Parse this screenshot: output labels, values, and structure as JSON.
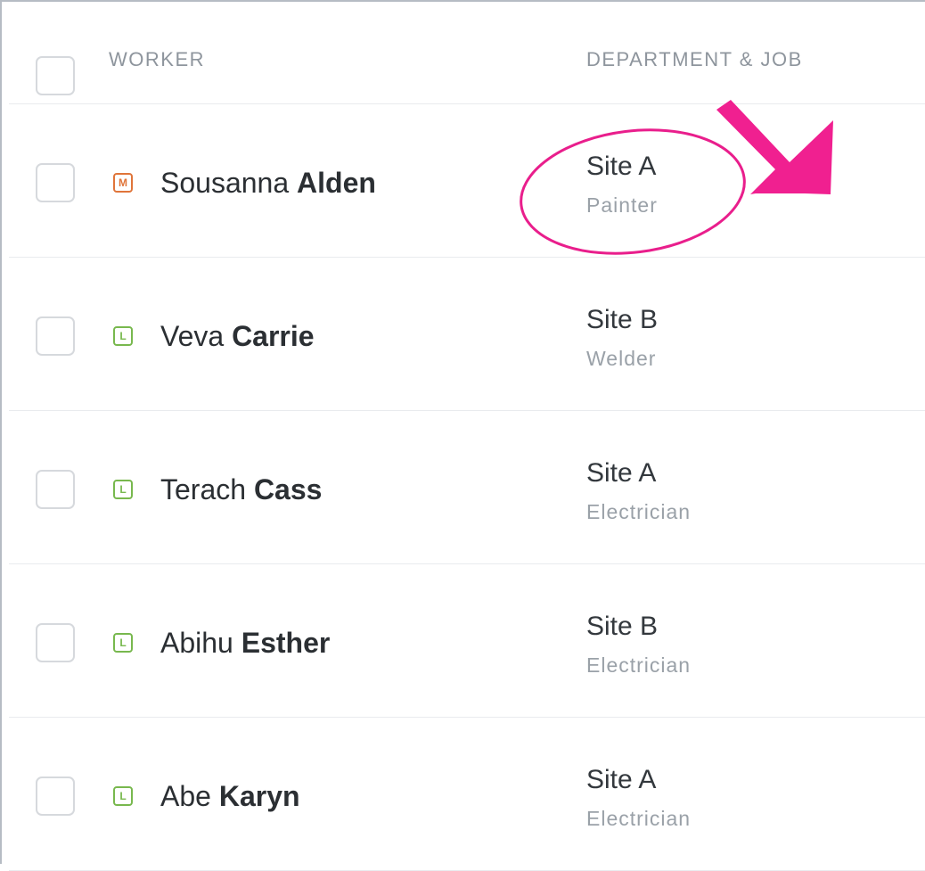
{
  "table": {
    "columns": {
      "worker": "WORKER",
      "department": "DEPARTMENT & JOB"
    },
    "rows": [
      {
        "badge": "M",
        "badge_color": "#e0753a",
        "first_name": "Sousanna",
        "last_name": "Alden",
        "site": "Site A",
        "job": "Painter"
      },
      {
        "badge": "L",
        "badge_color": "#78b84e",
        "first_name": "Veva",
        "last_name": "Carrie",
        "site": "Site B",
        "job": "Welder"
      },
      {
        "badge": "L",
        "badge_color": "#78b84e",
        "first_name": "Terach",
        "last_name": "Cass",
        "site": "Site A",
        "job": "Electrician"
      },
      {
        "badge": "L",
        "badge_color": "#78b84e",
        "first_name": "Abihu",
        "last_name": "Esther",
        "site": "Site B",
        "job": "Electrician"
      },
      {
        "badge": "L",
        "badge_color": "#78b84e",
        "first_name": "Abe",
        "last_name": "Karyn",
        "site": "Site A",
        "job": "Electrician"
      }
    ]
  },
  "annotation": {
    "color": "#e91e8c",
    "shapes": [
      "circle-highlight",
      "arrow-icon"
    ]
  }
}
